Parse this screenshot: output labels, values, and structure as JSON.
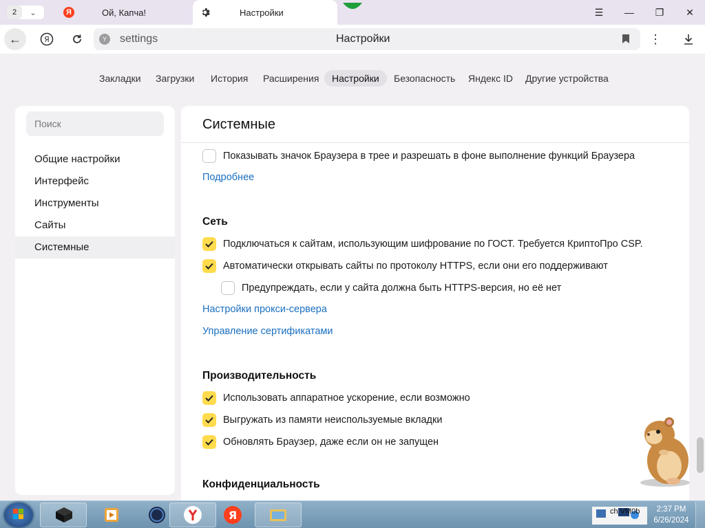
{
  "tabstrip": {
    "tab_count": "2",
    "tabs": [
      {
        "title": "Ой, Капча!",
        "icon": "yandex-icon"
      },
      {
        "title": "Настройки",
        "icon": "gear-icon"
      }
    ]
  },
  "addressbar": {
    "url": "settings",
    "page_title": "Настройки"
  },
  "settings_nav": [
    "Закладки",
    "Загрузки",
    "История",
    "Расширения",
    "Настройки",
    "Безопасность",
    "Яндекс ID",
    "Другие устройства"
  ],
  "sidebar": {
    "search_placeholder": "Поиск",
    "items": [
      "Общие настройки",
      "Интерфейс",
      "Инструменты",
      "Сайты",
      "Системные"
    ]
  },
  "main": {
    "title": "Системные",
    "tray_option": {
      "label": "Показывать значок Браузера в трее и разрешать в фоне выполнение функций Браузера",
      "checked": false
    },
    "more_link": "Подробнее",
    "network": {
      "title": "Сеть",
      "options": [
        {
          "label": "Подключаться к сайтам, использующим шифрование по ГОСТ. Требуется КриптоПро CSP.",
          "checked": true
        },
        {
          "label": "Автоматически открывать сайты по протоколу HTTPS, если они его поддерживают",
          "checked": true
        },
        {
          "label": "Предупреждать, если у сайта должна быть HTTPS-версия, но её нет",
          "checked": false
        }
      ],
      "proxy_link": "Настройки прокси-сервера",
      "certs_link": "Управление сертификатами"
    },
    "performance": {
      "title": "Производительность",
      "options": [
        {
          "label": "Использовать аппаратное ускорение, если возможно",
          "checked": true
        },
        {
          "label": "Выгружать из памяти неиспользуемые вкладки",
          "checked": true
        },
        {
          "label": "Обновлять Браузер, даже если он не запущен",
          "checked": true
        }
      ]
    },
    "privacy": {
      "title": "Конфиденциальность"
    }
  },
  "taskbar": {
    "tray_text": "ch VM0b",
    "time": "2:37 PM",
    "date": "6/26/2024"
  },
  "colors": {
    "accent_yellow": "#ffdb4d",
    "link_blue": "#1a6fbf",
    "yandex_red": "#fc3f1d"
  }
}
